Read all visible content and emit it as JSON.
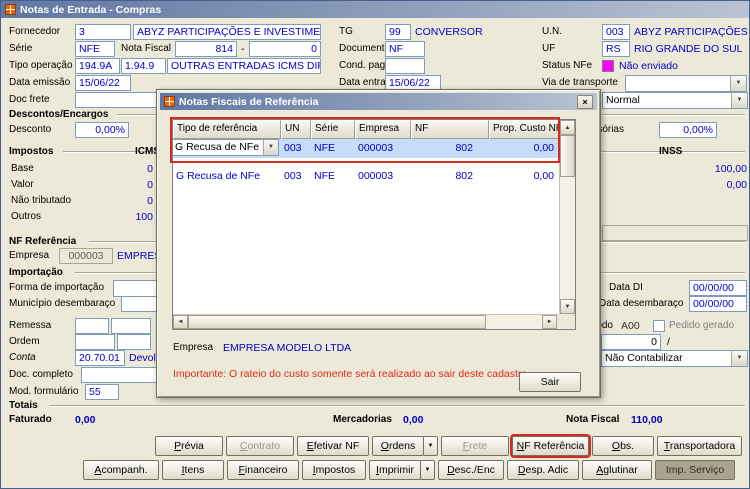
{
  "window": {
    "title": "Notas de Entrada - Compras"
  },
  "status_color": "#FF00FF",
  "form": {
    "fornecedor_label": "Fornecedor",
    "fornecedor_code": "3",
    "fornecedor_name": "ABYZ PARTICIPAÇÕES E INVESTIMENTOS LTDA",
    "tg_label": "TG",
    "tg_code": "99",
    "tg_name": "CONVERSOR",
    "un_label": "U.N.",
    "un_code": "003",
    "un_name": "ABYZ PARTICIPAÇÕES E INVESTIMENTOS LTDA",
    "serie_label": "Série",
    "serie": "NFE",
    "nota_fiscal_label": "Nota Fiscal",
    "nf_numero": "814",
    "nf_sep": "-",
    "nf_sub": "0",
    "documento_label": "Documento",
    "documento": "NF",
    "uf_label": "UF",
    "uf_code": "RS",
    "uf_name": "RIO GRANDE DO SUL",
    "tipo_operacao_label": "Tipo operação",
    "tipo_op_code1": "194.9A",
    "tipo_op_code2": "1.94.9",
    "tipo_op_desc": "OUTRAS ENTRADAS ICMS DIF/IPI SU",
    "cond_pag_label": "Cond. pag.",
    "status_nfe_label": "Status NFe",
    "status_nfe": "Não enviado",
    "data_emissao_label": "Data emissão",
    "data_emissao": "15/06/22",
    "data_entrada_label": "Data entrada",
    "data_entrada": "15/06/22",
    "via_transporte_label": "Via de transporte",
    "doc_frete_label": "Doc frete",
    "doc_frete_tipo": "Normal",
    "descontos_header": "Descontos/Encargos",
    "desconto_label": "Desconto",
    "desconto": "0,00%",
    "desp_acessorias_label": "Despesas acessórias",
    "desp_acessorias": "0,00%",
    "impostos_header": "Impostos",
    "icms_header": "ICMS",
    "inss_header": "INSS",
    "base_label": "Base",
    "valor_label": "Valor",
    "nao_tributado_label": "Não tributado",
    "outros_label": "Outros",
    "icms_base": "0",
    "icms_valor": "0",
    "icms_nao_tributado": "0",
    "icms_outros": "100",
    "inss_base": "100,00",
    "inss_valor": "0,00",
    "nf_ref_header": "NF Referência",
    "empresa_label": "Empresa",
    "empresa_code": "000003",
    "empresa_name": "EMPRESA MODELO LTDA",
    "importacao_header": "Importação",
    "forma_importacao_label": "Forma de importação",
    "municipio_label": "Município desembaraço",
    "data_di_label": "Data DI",
    "data_di": "00/00/00",
    "data_desembaraco_label": "Data desembaraço",
    "data_desembaraco": "00/00/00",
    "remessa_label": "Remessa",
    "ordem_label": "Ordem",
    "periodo_label": "Período",
    "periodo": "A00",
    "pedido_gerado_label": "Pedido gerado",
    "pedido_num": "0",
    "pedido_sep": "/",
    "conta_label": "Conta",
    "conta": "20.70.01",
    "conta_desc": "Devoluções",
    "contabilizar": "Não Contabilizar",
    "doc_completo_label": "Doc. completo",
    "mod_formulario_label": "Mod. formulário",
    "mod_formulario": "55",
    "totais_header": "Totais",
    "faturado_label": "Faturado",
    "faturado": "0,00",
    "mercadorias_label": "Mercadorias",
    "mercadorias": "0,00",
    "nota_fiscal_total_label": "Nota Fiscal",
    "nota_fiscal_total": "110,00"
  },
  "modal": {
    "title": "Notas Fiscais de Referência",
    "table": {
      "columns": [
        "Tipo de referência",
        "UN",
        "Série",
        "Empresa",
        "NF",
        "Prop. Custo NF Ref."
      ],
      "rows": [
        {
          "tipo": "G Recusa de NFe",
          "un": "003",
          "serie": "NFE",
          "empresa": "000003",
          "nf": "802",
          "prop": "0,00",
          "selected": true,
          "combo": true
        },
        {
          "tipo": "G Recusa de NFe",
          "un": "003",
          "serie": "NFE",
          "empresa": "000003",
          "nf": "802",
          "prop": "0,00",
          "selected": false,
          "combo": false
        }
      ]
    },
    "empresa_label": "Empresa",
    "empresa_name": "EMPRESA MODELO LTDA",
    "warning": "Importante: O rateio do custo somente será realizado ao sair deste cadastro.",
    "sair_label": "Sair"
  },
  "footer": {
    "row1": [
      {
        "label": "Prévia",
        "u": 0,
        "state": "normal"
      },
      {
        "label": "Contrato",
        "u": 0,
        "state": "disabled"
      },
      {
        "label": "Efetivar NF",
        "u": 0,
        "state": "normal"
      },
      {
        "label": "Ordens",
        "u": 0,
        "state": "normal",
        "arrow": true
      },
      {
        "label": "Frete",
        "u": 0,
        "state": "disabled"
      },
      {
        "label": "NF Referência",
        "u": 0,
        "state": "highlight"
      },
      {
        "label": "Obs.",
        "u": 0,
        "state": "normal"
      },
      {
        "label": "Transportadora",
        "u": 0,
        "state": "normal"
      }
    ],
    "row2": [
      {
        "label": "Acompanh.",
        "u": 0,
        "state": "normal"
      },
      {
        "label": "Itens",
        "u": 0,
        "state": "normal"
      },
      {
        "label": "Financeiro",
        "u": 0,
        "state": "normal"
      },
      {
        "label": "Impostos",
        "u": 0,
        "state": "normal"
      },
      {
        "label": "Imprimir",
        "u": 0,
        "state": "normal",
        "arrow": true
      },
      {
        "label": "Desc./Enc",
        "u": 0,
        "state": "normal"
      },
      {
        "label": "Desp. Adic",
        "u": 0,
        "state": "normal"
      },
      {
        "label": "Aglutinar",
        "u": 0,
        "state": "normal"
      },
      {
        "label": "Imp. Serviço",
        "u": null,
        "state": "dark"
      }
    ]
  }
}
